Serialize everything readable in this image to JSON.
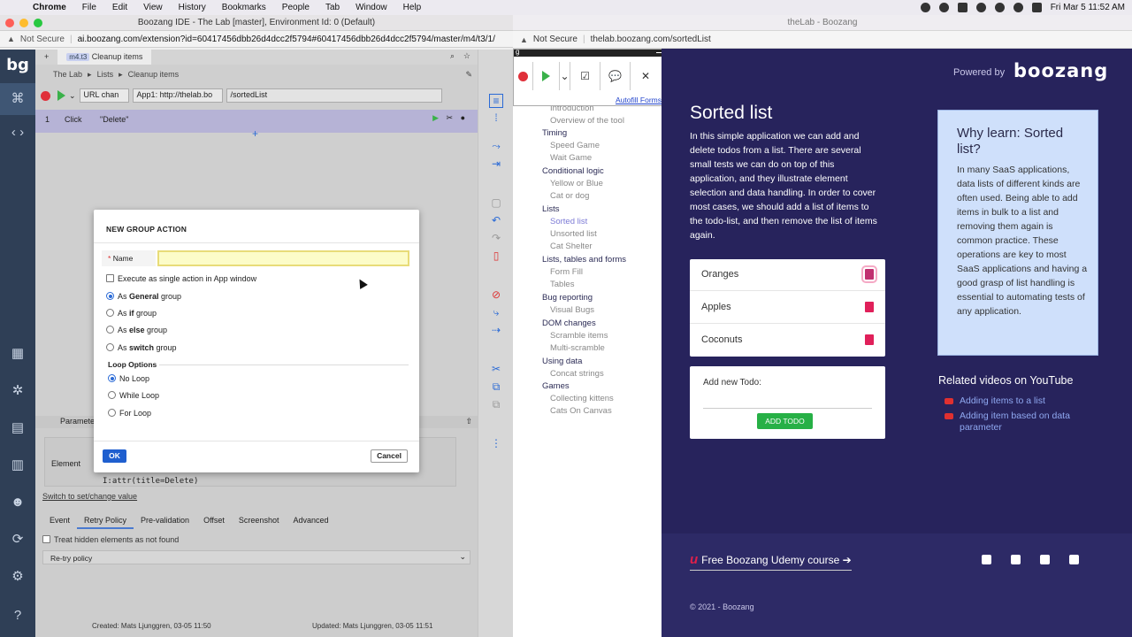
{
  "menubar": {
    "app": "Chrome",
    "items": [
      "File",
      "Edit",
      "View",
      "History",
      "Bookmarks",
      "People",
      "Tab",
      "Window",
      "Help"
    ],
    "datetime": "Fri Mar 5  11:52 AM"
  },
  "left_window": {
    "title": "Boozang IDE - The Lab [master], Environment Id: 0 (Default)",
    "not_secure": "Not Secure",
    "url": "ai.boozang.com/extension?id=60417456dbb26d4dcc2f5794#60417456dbb26d4dcc2f5794/master/m4/t3/1/",
    "logo": "bg",
    "tab_plus": "+",
    "tab_badge": "m4.t3",
    "tab_label": "Cleanup items",
    "crumb_1": "The Lab",
    "crumb_2": "Lists",
    "crumb_3": "Cleanup items",
    "url_mode": "URL chan",
    "app_select": "App1: http://thelab.bo",
    "path": "/sortedList",
    "action_num": "1",
    "action_type": "Click",
    "action_target": "\"Delete\"",
    "plus": "+",
    "params_tab": "Parameter",
    "element_label": "Element",
    "element_value": "I:attr(title=Delete)",
    "switch_link": "Switch to set/change value",
    "subtabs": [
      "Event",
      "Retry Policy",
      "Pre-validation",
      "Offset",
      "Screenshot",
      "Advanced"
    ],
    "treat_hidden": "Treat hidden elements as not found",
    "retry_label": "Re-try policy",
    "created": "Created: Mats Ljunggren, 03-05 11:50",
    "updated": "Updated: Mats Ljunggren, 03-05 11:51"
  },
  "dialog": {
    "title": "NEW GROUP ACTION",
    "name_label": "Name",
    "required_mark": "*",
    "name_value": "",
    "execute_single": "Execute as single action in App window",
    "as_general_a": "As ",
    "as_general_b": "General",
    "as_general_c": " group",
    "as_if_a": "As ",
    "as_if_b": "if",
    "as_if_c": " group",
    "as_else_a": "As ",
    "as_else_b": "else",
    "as_else_c": " group",
    "as_switch_a": "As ",
    "as_switch_b": "switch",
    "as_switch_c": " group",
    "loop_options": "Loop Options",
    "no_loop": "No Loop",
    "while_loop": "While Loop",
    "for_loop": "For Loop",
    "ok": "OK",
    "cancel": "Cancel"
  },
  "right_window": {
    "title": "theLab - Boozang",
    "not_secure": "Not Secure",
    "url": "thelab.boozang.com/sortedList",
    "widget_title": "g",
    "autofill": "Autofill Forms",
    "powered_by": "Powered by",
    "brand": "boozang",
    "nav": [
      {
        "label": "Introduction",
        "sub": true
      },
      {
        "label": "Overview of the tool",
        "sub": true
      },
      {
        "label": "Timing",
        "sub": false
      },
      {
        "label": "Speed Game",
        "sub": true
      },
      {
        "label": "Wait Game",
        "sub": true
      },
      {
        "label": "Conditional logic",
        "sub": false
      },
      {
        "label": "Yellow or Blue",
        "sub": true
      },
      {
        "label": "Cat or dog",
        "sub": true
      },
      {
        "label": "Lists",
        "sub": false
      },
      {
        "label": "Sorted list",
        "sub": true,
        "active": true
      },
      {
        "label": "Unsorted list",
        "sub": true
      },
      {
        "label": "Cat Shelter",
        "sub": true
      },
      {
        "label": "Lists, tables and forms",
        "sub": false
      },
      {
        "label": "Form Fill",
        "sub": true
      },
      {
        "label": "Tables",
        "sub": true
      },
      {
        "label": "Bug reporting",
        "sub": false
      },
      {
        "label": "Visual Bugs",
        "sub": true
      },
      {
        "label": "DOM changes",
        "sub": false
      },
      {
        "label": "Scramble items",
        "sub": true
      },
      {
        "label": "Multi-scramble",
        "sub": true
      },
      {
        "label": "Using data",
        "sub": false
      },
      {
        "label": "Concat strings",
        "sub": true
      },
      {
        "label": "Games",
        "sub": false
      },
      {
        "label": "Collecting kittens",
        "sub": true
      },
      {
        "label": "Cats On Canvas",
        "sub": true
      }
    ],
    "heading": "Sorted list",
    "intro": "In this simple application we can add and delete todos from a list. There are several small tests we can do on top of this application, and they illustrate element selection and data handling. In order to cover most cases, we should add a list of items to the todo-list, and then remove the list of items again.",
    "items": [
      "Oranges",
      "Apples",
      "Coconuts"
    ],
    "add_label": "Add new Todo:",
    "add_button": "ADD TODO",
    "why_title": "Why learn: Sorted list?",
    "why_body": "In many SaaS applications, data lists of different kinds are often used. Being able to add items in bulk to a list and removing them again is common practice. These operations are key to most SaaS applications and having a good grasp of list handling is essential to automating tests of any application.",
    "related": "Related videos on YouTube",
    "video_1": "Adding items to a list",
    "video_2": "Adding item based on data parameter",
    "udemy_logo": "u",
    "udemy": "Free Boozang Udemy course",
    "copyright": "© 2021 - Boozang"
  },
  "colors": {
    "accent": "#1f5fcf",
    "lab_bg": "#27235c",
    "trash": "#e0205a",
    "add_button": "#27b046"
  }
}
